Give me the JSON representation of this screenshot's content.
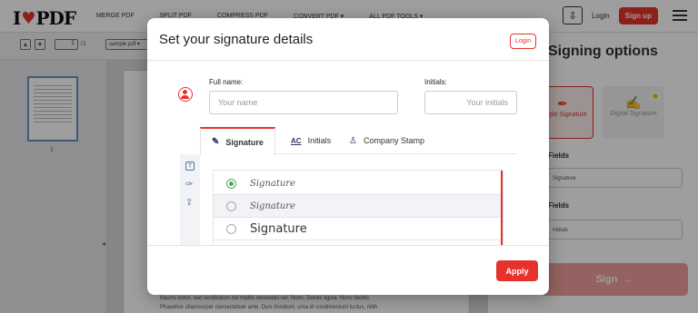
{
  "app": {
    "logo_left": "I",
    "logo_right": "PDF",
    "nav": [
      "MERGE PDF",
      "SPLIT PDF",
      "COMPRESS PDF",
      "CONVERT PDF ▾",
      "ALL PDF TOOLS ▾"
    ],
    "login": "Login",
    "signup": "Sign up"
  },
  "viewer": {
    "page_current": "1",
    "page_total": "/1",
    "file_select": "sample.pdf ▾",
    "thumb_number": "1",
    "doc_text": [
      "Mauris tortor, sed vestibulum dui mattis venenatis vel. Nunc. Donec ligula. Nunc facilisi.",
      "Phasellus ullamcorper consectetuer ante. Duis tincidunt, urna id condimentum luctus, nibh"
    ]
  },
  "right_panel": {
    "title": "Signing options",
    "options": [
      {
        "label": "Simple Signature"
      },
      {
        "label": "Digital Signature"
      }
    ],
    "required_fields_label": "Fields",
    "required_field_value": "Signature",
    "optional_fields_label": "Fields",
    "optional_field_value": "Initials",
    "sign_label": "Sign",
    "sign_icon": "→"
  },
  "modal": {
    "title": "Set your signature details",
    "login_label": "Login",
    "full_name_label": "Full name:",
    "full_name_placeholder": "Your name",
    "initials_label": "Initials:",
    "initials_placeholder": "Your initials",
    "tabs": [
      {
        "label": "Signature",
        "icon": "pen-icon"
      },
      {
        "label": "Initials",
        "icon": "ac-icon"
      },
      {
        "label": "Company Stamp",
        "icon": "stamp-icon"
      }
    ],
    "signature_options": [
      {
        "text": "Signature",
        "selected": true
      },
      {
        "text": "Signature",
        "selected": false
      },
      {
        "text": "Signature",
        "selected": false
      }
    ],
    "apply_label": "Apply",
    "accent_color": "#e5322d"
  }
}
